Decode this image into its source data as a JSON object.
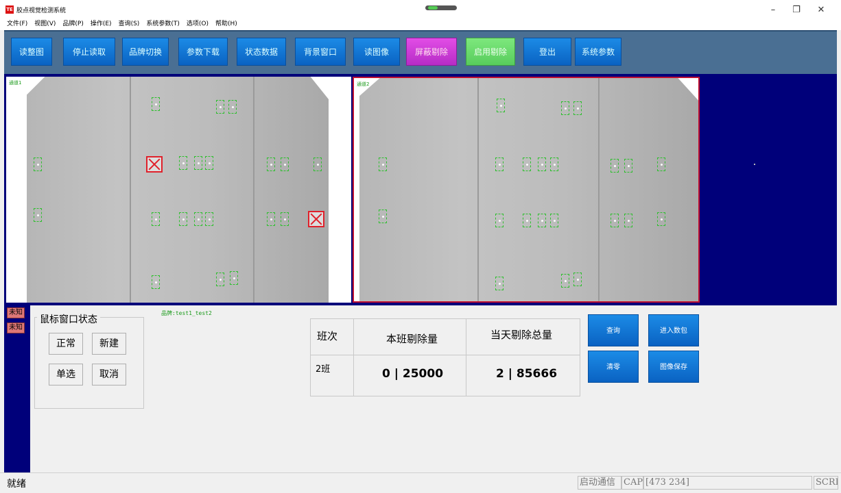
{
  "window": {
    "title": "胶点视觉检测系统",
    "icon_text": "TE",
    "minimize": "–",
    "restore": "❐",
    "close": "✕"
  },
  "menu": [
    "文件(F)",
    "视图(V)",
    "品牌(P)",
    "操作(E)",
    "查询(S)",
    "系统参数(T)",
    "选项(O)",
    "帮助(H)"
  ],
  "toolbar": {
    "buttons": [
      "读整图",
      "停止读取",
      "品牌切换",
      "参数下载",
      "状态数据",
      "背景窗口",
      "读图像",
      "屏蔽剔除",
      "启用剔除",
      "登出",
      "系统参数"
    ],
    "highlight_colors": {
      "屏蔽剔除": "#d63ad8",
      "启用剔除": "#6edb70"
    },
    "default_color": "#1a7fe0"
  },
  "cameras": [
    {
      "label": "通道1"
    },
    {
      "label": "通道2"
    }
  ],
  "status_flags": [
    "未知",
    "未知"
  ],
  "mouse_panel": {
    "title": "鼠标窗口状态",
    "buttons": [
      "正常",
      "新建",
      "单选",
      "取消"
    ]
  },
  "brand_label": "品牌:test1_test2",
  "stats": {
    "headers": [
      "班次",
      "本班剔除量",
      "当天剔除总量"
    ],
    "shift": "2班",
    "shift_reject": "0 | 25000",
    "day_reject": "2 | 85666"
  },
  "actions": [
    "查询",
    "进入数包",
    "清零",
    "图像保存"
  ],
  "statusbar": {
    "ready": "就绪",
    "comm": "启动通信",
    "cap": "CAP",
    "coords": "[473 234]",
    "scrl": "SCRL"
  }
}
